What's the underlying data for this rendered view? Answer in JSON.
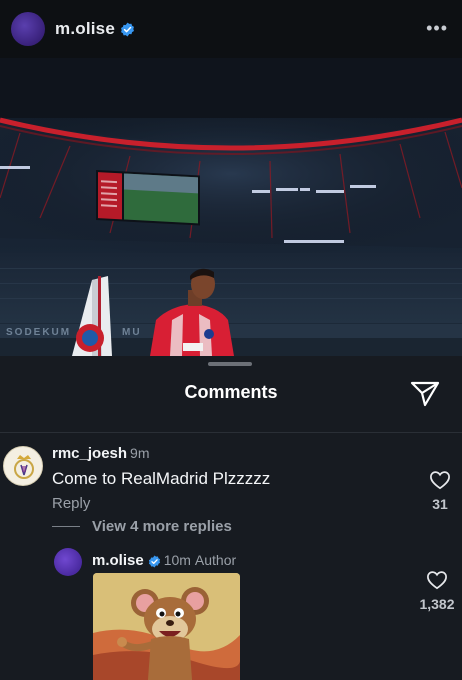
{
  "header": {
    "username": "m.olise",
    "more_label": "•••"
  },
  "photo": {
    "banner_text": "SODEKUM",
    "banner_text_right": "MU"
  },
  "comments_sheet": {
    "title": "Comments"
  },
  "comments": [
    {
      "username": "rmc_joesh",
      "time": "9m",
      "text": "Come to RealMadrid Plzzzzz",
      "reply_label": "Reply",
      "more_replies_label": "View 4 more replies",
      "likes": "31"
    },
    {
      "username": "m.olise",
      "time": "10m",
      "author_label": "Author",
      "likes": "1,382"
    }
  ],
  "colors": {
    "sheet_bg": "#171b21",
    "verified_blue": "#3897f0",
    "bayern_red": "#dc052d"
  }
}
